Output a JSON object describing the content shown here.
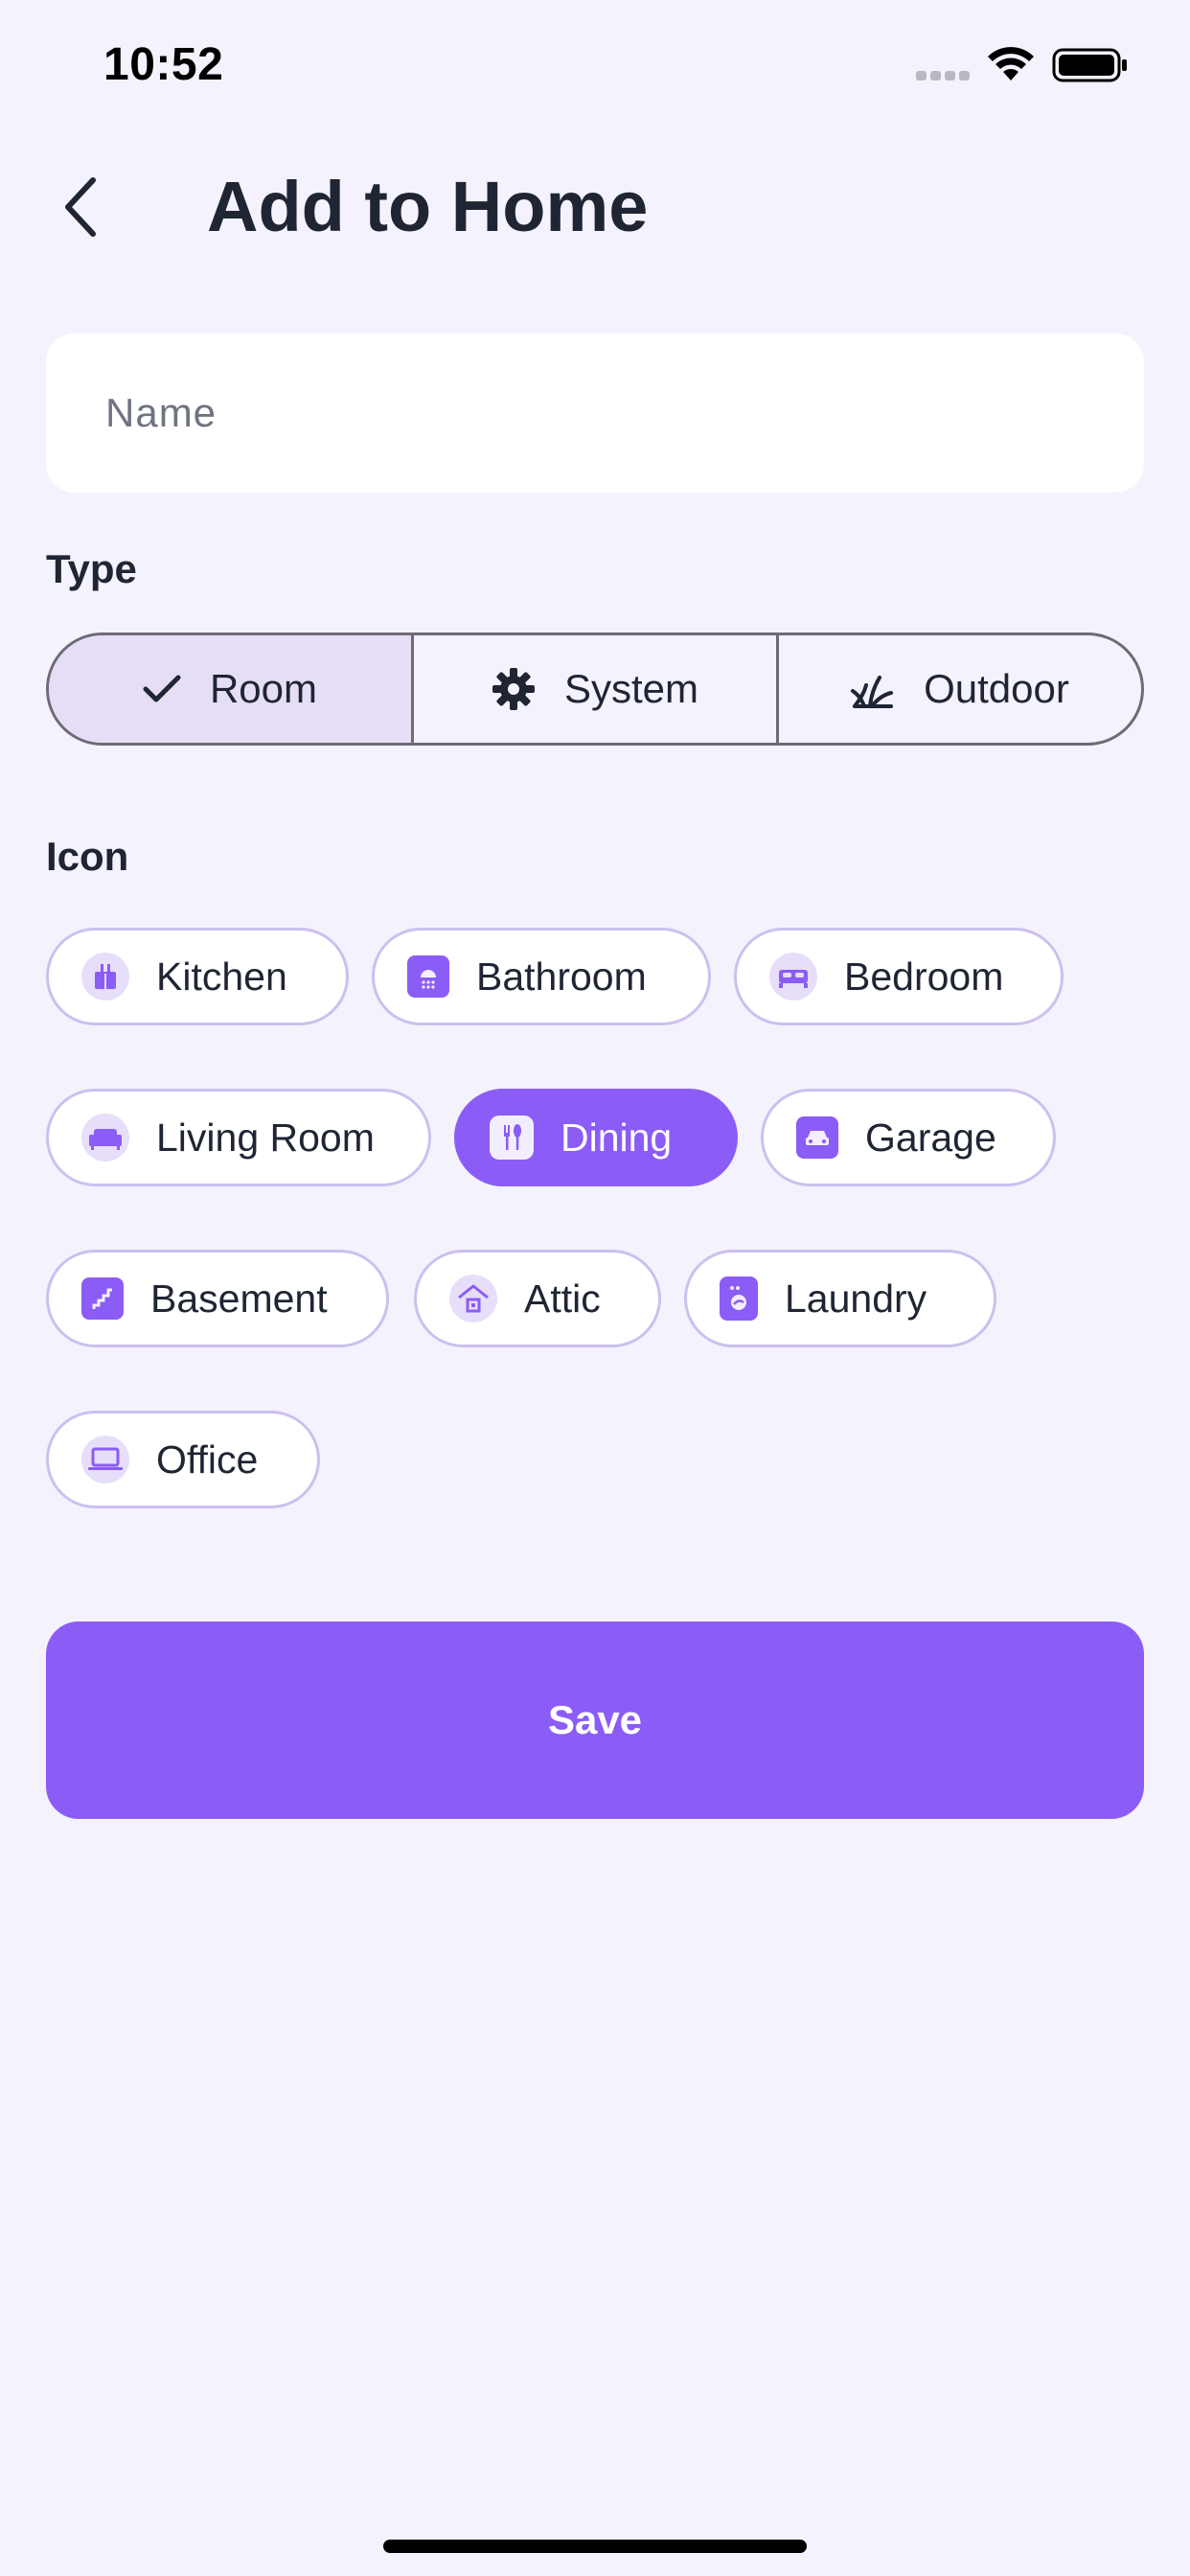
{
  "status_bar": {
    "time": "10:52"
  },
  "header": {
    "title": "Add to Home"
  },
  "name_field": {
    "placeholder": "Name",
    "value": ""
  },
  "type_section": {
    "label": "Type",
    "options": [
      {
        "label": "Room",
        "icon": "check-icon",
        "selected": true
      },
      {
        "label": "System",
        "icon": "gear-icon",
        "selected": false
      },
      {
        "label": "Outdoor",
        "icon": "grass-icon",
        "selected": false
      }
    ]
  },
  "icon_section": {
    "label": "Icon",
    "chips": [
      {
        "label": "Kitchen",
        "icon": "kitchen-icon",
        "selected": false
      },
      {
        "label": "Bathroom",
        "icon": "bathroom-icon",
        "selected": false
      },
      {
        "label": "Bedroom",
        "icon": "bed-icon",
        "selected": false
      },
      {
        "label": "Living Room",
        "icon": "sofa-icon",
        "selected": false
      },
      {
        "label": "Dining",
        "icon": "dining-icon",
        "selected": true
      },
      {
        "label": "Garage",
        "icon": "car-icon",
        "selected": false
      },
      {
        "label": "Basement",
        "icon": "stairs-icon",
        "selected": false
      },
      {
        "label": "Attic",
        "icon": "house-icon",
        "selected": false
      },
      {
        "label": "Laundry",
        "icon": "washer-icon",
        "selected": false
      },
      {
        "label": "Office",
        "icon": "laptop-icon",
        "selected": false
      }
    ]
  },
  "save_button": {
    "label": "Save"
  },
  "colors": {
    "accent": "#8B5CF6",
    "background": "#F4F2FC",
    "segment_selected": "#E6DEF6",
    "text": "#1F2533"
  }
}
